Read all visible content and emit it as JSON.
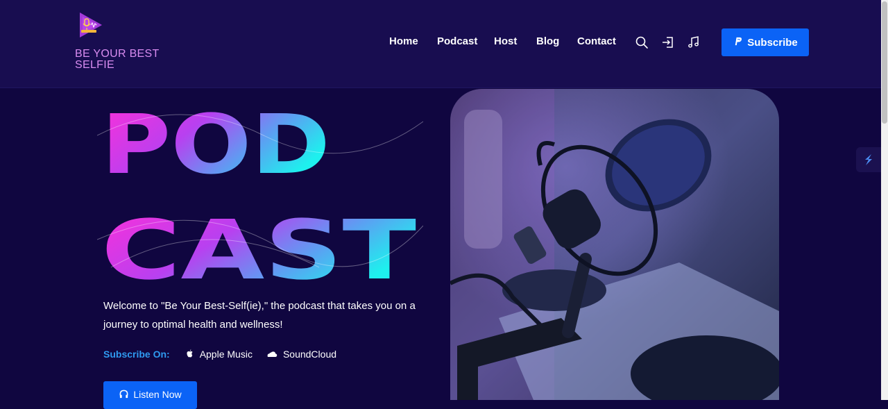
{
  "header": {
    "brand_name": "BE YOUR BEST SELFIE",
    "nav": [
      "Home",
      "Podcast",
      "Host",
      "Blog",
      "Contact"
    ],
    "icons": [
      "search-icon",
      "login-icon",
      "music-note-icon",
      "paypal-icon"
    ],
    "subscribe_label": "Subscribe"
  },
  "hero": {
    "title_line1": "POD",
    "title_line2": "CAST",
    "intro": "Welcome to \"Be Your Best-Self(ie),\" the podcast that takes you on a journey to optimal health and wellness!",
    "subscribe_on_label": "Subscribe On:",
    "platforms": [
      {
        "name": "Apple Music",
        "icon": "apple-icon"
      },
      {
        "name": "SoundCloud",
        "icon": "soundcloud-icon"
      }
    ],
    "listen_label": "Listen Now"
  },
  "colors": {
    "background": "#100640",
    "header_background": "#180d50",
    "accent_blue": "#0b63f6",
    "brand_pink": "#d88cf0",
    "label_blue": "#2f9af0",
    "title_gradient": [
      "#ff2fd8",
      "#b840f0",
      "#1ef0ee"
    ]
  }
}
